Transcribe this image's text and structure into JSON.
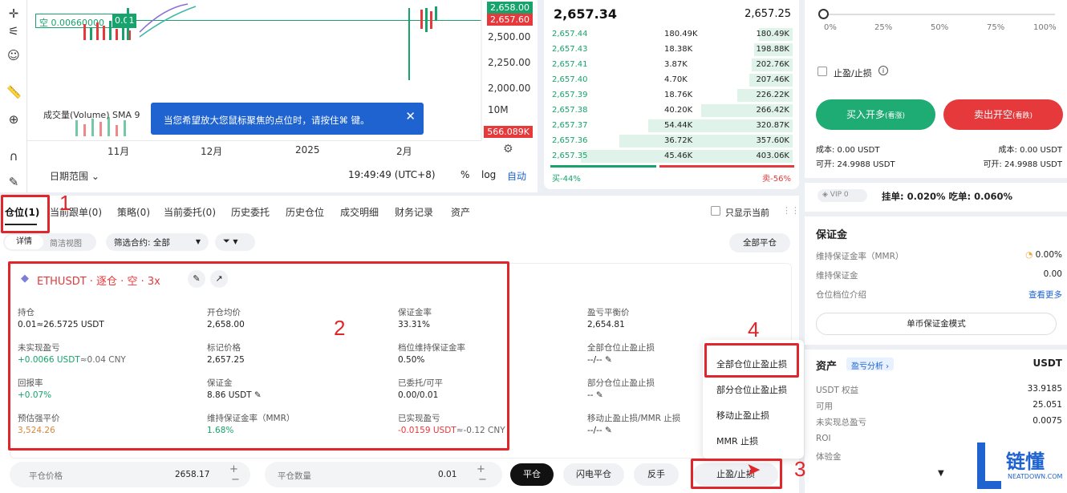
{
  "colors": {
    "green": "#17a36b",
    "red": "#e5393c",
    "annotation": "#e0262b",
    "blue": "#1e63d0"
  },
  "chart": {
    "position_label": "空 0.00660000",
    "position_value": "0.01",
    "price_labels": [
      "2,500.00",
      "2,250.00",
      "2,000.00"
    ],
    "tag_top": "2,658.00",
    "tag_current": "2,657.60",
    "volume_tag": "566.089K",
    "volume_axis": "10M",
    "volume_title": "成交量(Volume) SMA 9",
    "x_labels": [
      "11月",
      "12月",
      "2025",
      "2月"
    ],
    "date_range": "日期范围",
    "time": "19:49:49 (UTC+8)",
    "pct": "%",
    "log": "log",
    "auto": "自动",
    "tooltip": "当您希望放大您鼠标聚焦的点位时，请按住⌘ 键。"
  },
  "orderbook": {
    "last_price": "2,657.34",
    "mark_price": "2,657.25",
    "rows": [
      {
        "price": "2,657.44",
        "size": "180.49K",
        "total": "180.49K",
        "fill": 0.14
      },
      {
        "price": "2,657.43",
        "size": "18.38K",
        "total": "198.88K",
        "fill": 0.16
      },
      {
        "price": "2,657.41",
        "size": "3.87K",
        "total": "202.76K",
        "fill": 0.17
      },
      {
        "price": "2,657.40",
        "size": "4.70K",
        "total": "207.46K",
        "fill": 0.18
      },
      {
        "price": "2,657.39",
        "size": "18.76K",
        "total": "226.22K",
        "fill": 0.23
      },
      {
        "price": "2,657.38",
        "size": "40.20K",
        "total": "266.42K",
        "fill": 0.38
      },
      {
        "price": "2,657.37",
        "size": "54.44K",
        "total": "320.87K",
        "fill": 0.6
      },
      {
        "price": "2,657.36",
        "size": "36.72K",
        "total": "357.60K",
        "fill": 0.72
      },
      {
        "price": "2,657.35",
        "size": "45.46K",
        "total": "403.06K",
        "fill": 0.88
      }
    ],
    "buy_ratio": "买-44%",
    "sell_ratio": "卖-56%"
  },
  "right": {
    "slider_marks": [
      "0%",
      "25%",
      "50%",
      "75%",
      "100%"
    ],
    "tpsl_label": "止盈/止损",
    "buy_button": "买入开多",
    "buy_sub": "(看涨)",
    "sell_button": "卖出开空",
    "sell_sub": "(看跌)",
    "cost_left": "成本: 0.00 USDT",
    "cost_right": "成本: 0.00 USDT",
    "avail_left": "可开: 24.9988 USDT",
    "avail_right": "可开: 24.9988 USDT",
    "vip": "VIP 0",
    "fees": "挂单: 0.020%  吃单: 0.060%",
    "margin_title": "保证金",
    "mmr_label": "维持保证金率（MMR）",
    "mmr_value": "0.00%",
    "maint_label": "维持保证金",
    "maint_value": "0.00",
    "tier_label": "仓位档位介绍",
    "see_more": "查看更多",
    "single_mode": "单币保证金模式",
    "assets_title": "资产",
    "pnl_analysis": "盈亏分析",
    "currency": "USDT",
    "assets": [
      {
        "label": "USDT 权益",
        "value": "33.9185"
      },
      {
        "label": "可用",
        "value": "25.051"
      },
      {
        "label": "未实现总盈亏",
        "value": "0.0075"
      },
      {
        "label": "ROI",
        "value": ""
      },
      {
        "label": "体验金",
        "value": ""
      }
    ]
  },
  "positions": {
    "tabs": [
      "仓位(1)",
      "当前跟单(0)",
      "策略(0)",
      "当前委托(0)",
      "历史委托",
      "历史仓位",
      "成交明细",
      "财务记录",
      "资产"
    ],
    "only_current": "只显示当前",
    "view_detail": "详情",
    "view_simple": "简洁视图",
    "filter": "筛选合约: 全部",
    "close_all": "全部平仓",
    "symbol": "ETHUSDT · 逐仓 · 空 · 3x",
    "fields": [
      {
        "label": "持仓",
        "value": "0.01≈26.5725 USDT"
      },
      {
        "label": "开仓均价",
        "value": "2,658.00"
      },
      {
        "label": "保证金率",
        "value": "33.31%"
      },
      {
        "label": "盈亏平衡价",
        "value": "2,654.81"
      },
      {
        "label": "未实现盈亏",
        "value": "+0.0066 USDT",
        "suffix": "≈0.04 CNY"
      },
      {
        "label": "标记价格",
        "value": "2,657.25"
      },
      {
        "label": "档位维持保证金率",
        "value": "0.50%"
      },
      {
        "label": "全部仓位止盈止损",
        "value": "--/--"
      },
      {
        "label": "回报率",
        "value": "+0.07%"
      },
      {
        "label": "保证金",
        "value": "8.86 USDT"
      },
      {
        "label": "已委托/可平",
        "value": "0.00/0.01"
      },
      {
        "label": "部分仓位止盈止损",
        "value": "--"
      },
      {
        "label": "预估强平价",
        "value": "3,524.26"
      },
      {
        "label": "维持保证金率（MMR）",
        "value": "1.68%"
      },
      {
        "label": "已实现盈亏",
        "value": "-0.0159 USDT",
        "suffix": "≈-0.12 CNY"
      },
      {
        "label": "移动止盈止损/MMR 止损",
        "value": "--/--"
      }
    ],
    "close_price_label": "平仓价格",
    "close_price_value": "2658.17",
    "close_qty_label": "平仓数量",
    "close_qty_value": "0.01",
    "btn_close": "平仓",
    "btn_flash": "闪电平仓",
    "btn_reverse": "反手",
    "btn_tpsl": "止盈/止损",
    "menu": [
      "全部仓位止盈止损",
      "部分仓位止盈止损",
      "移动止盈止损",
      "MMR 止损"
    ]
  },
  "annotations": [
    "1",
    "2",
    "3",
    "4"
  ],
  "brand": {
    "name": "链懂",
    "domain": "NEATDOWN.COM",
    "logo_letter": "L"
  }
}
